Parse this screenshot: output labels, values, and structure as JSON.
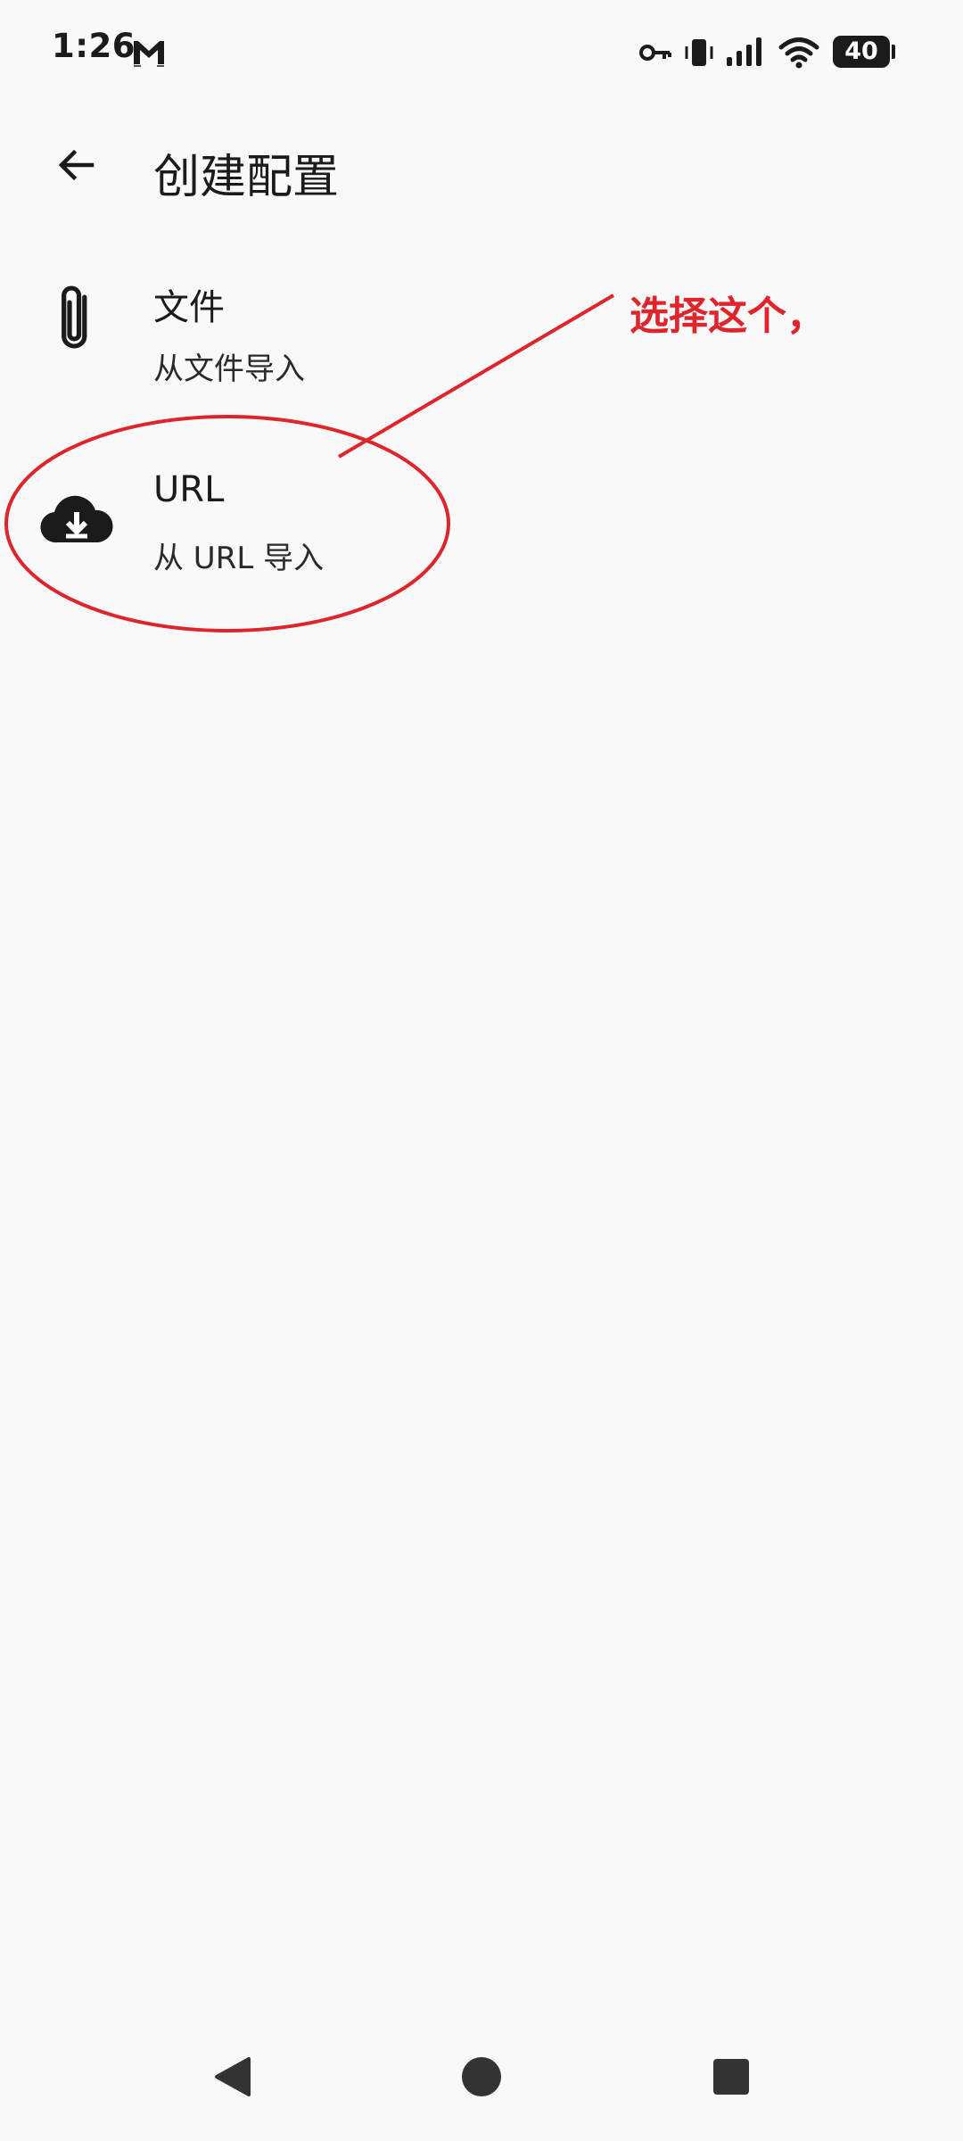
{
  "status_bar": {
    "time": "1:26",
    "battery": "40",
    "icons": [
      "gmail-icon",
      "vpn-key-icon",
      "vibrate-icon",
      "signal-icon",
      "wifi-icon",
      "battery-icon"
    ]
  },
  "app_bar": {
    "title": "创建配置",
    "back_icon": "arrow-left-icon"
  },
  "list": {
    "items": [
      {
        "title": "文件",
        "subtitle": "从文件导入",
        "icon": "paperclip-icon"
      },
      {
        "title": "URL",
        "subtitle": "从 URL 导入",
        "icon": "cloud-download-icon"
      }
    ]
  },
  "annotation": {
    "text": "选择这个，",
    "color": "#e0242c"
  },
  "nav_bar": {
    "icons": [
      "nav-back-icon",
      "nav-home-icon",
      "nav-recents-icon"
    ]
  },
  "colors": {
    "background": "#f9f9f9",
    "text": "#1b1b1b",
    "annotation": "#e0242c",
    "nav": "#333333"
  }
}
